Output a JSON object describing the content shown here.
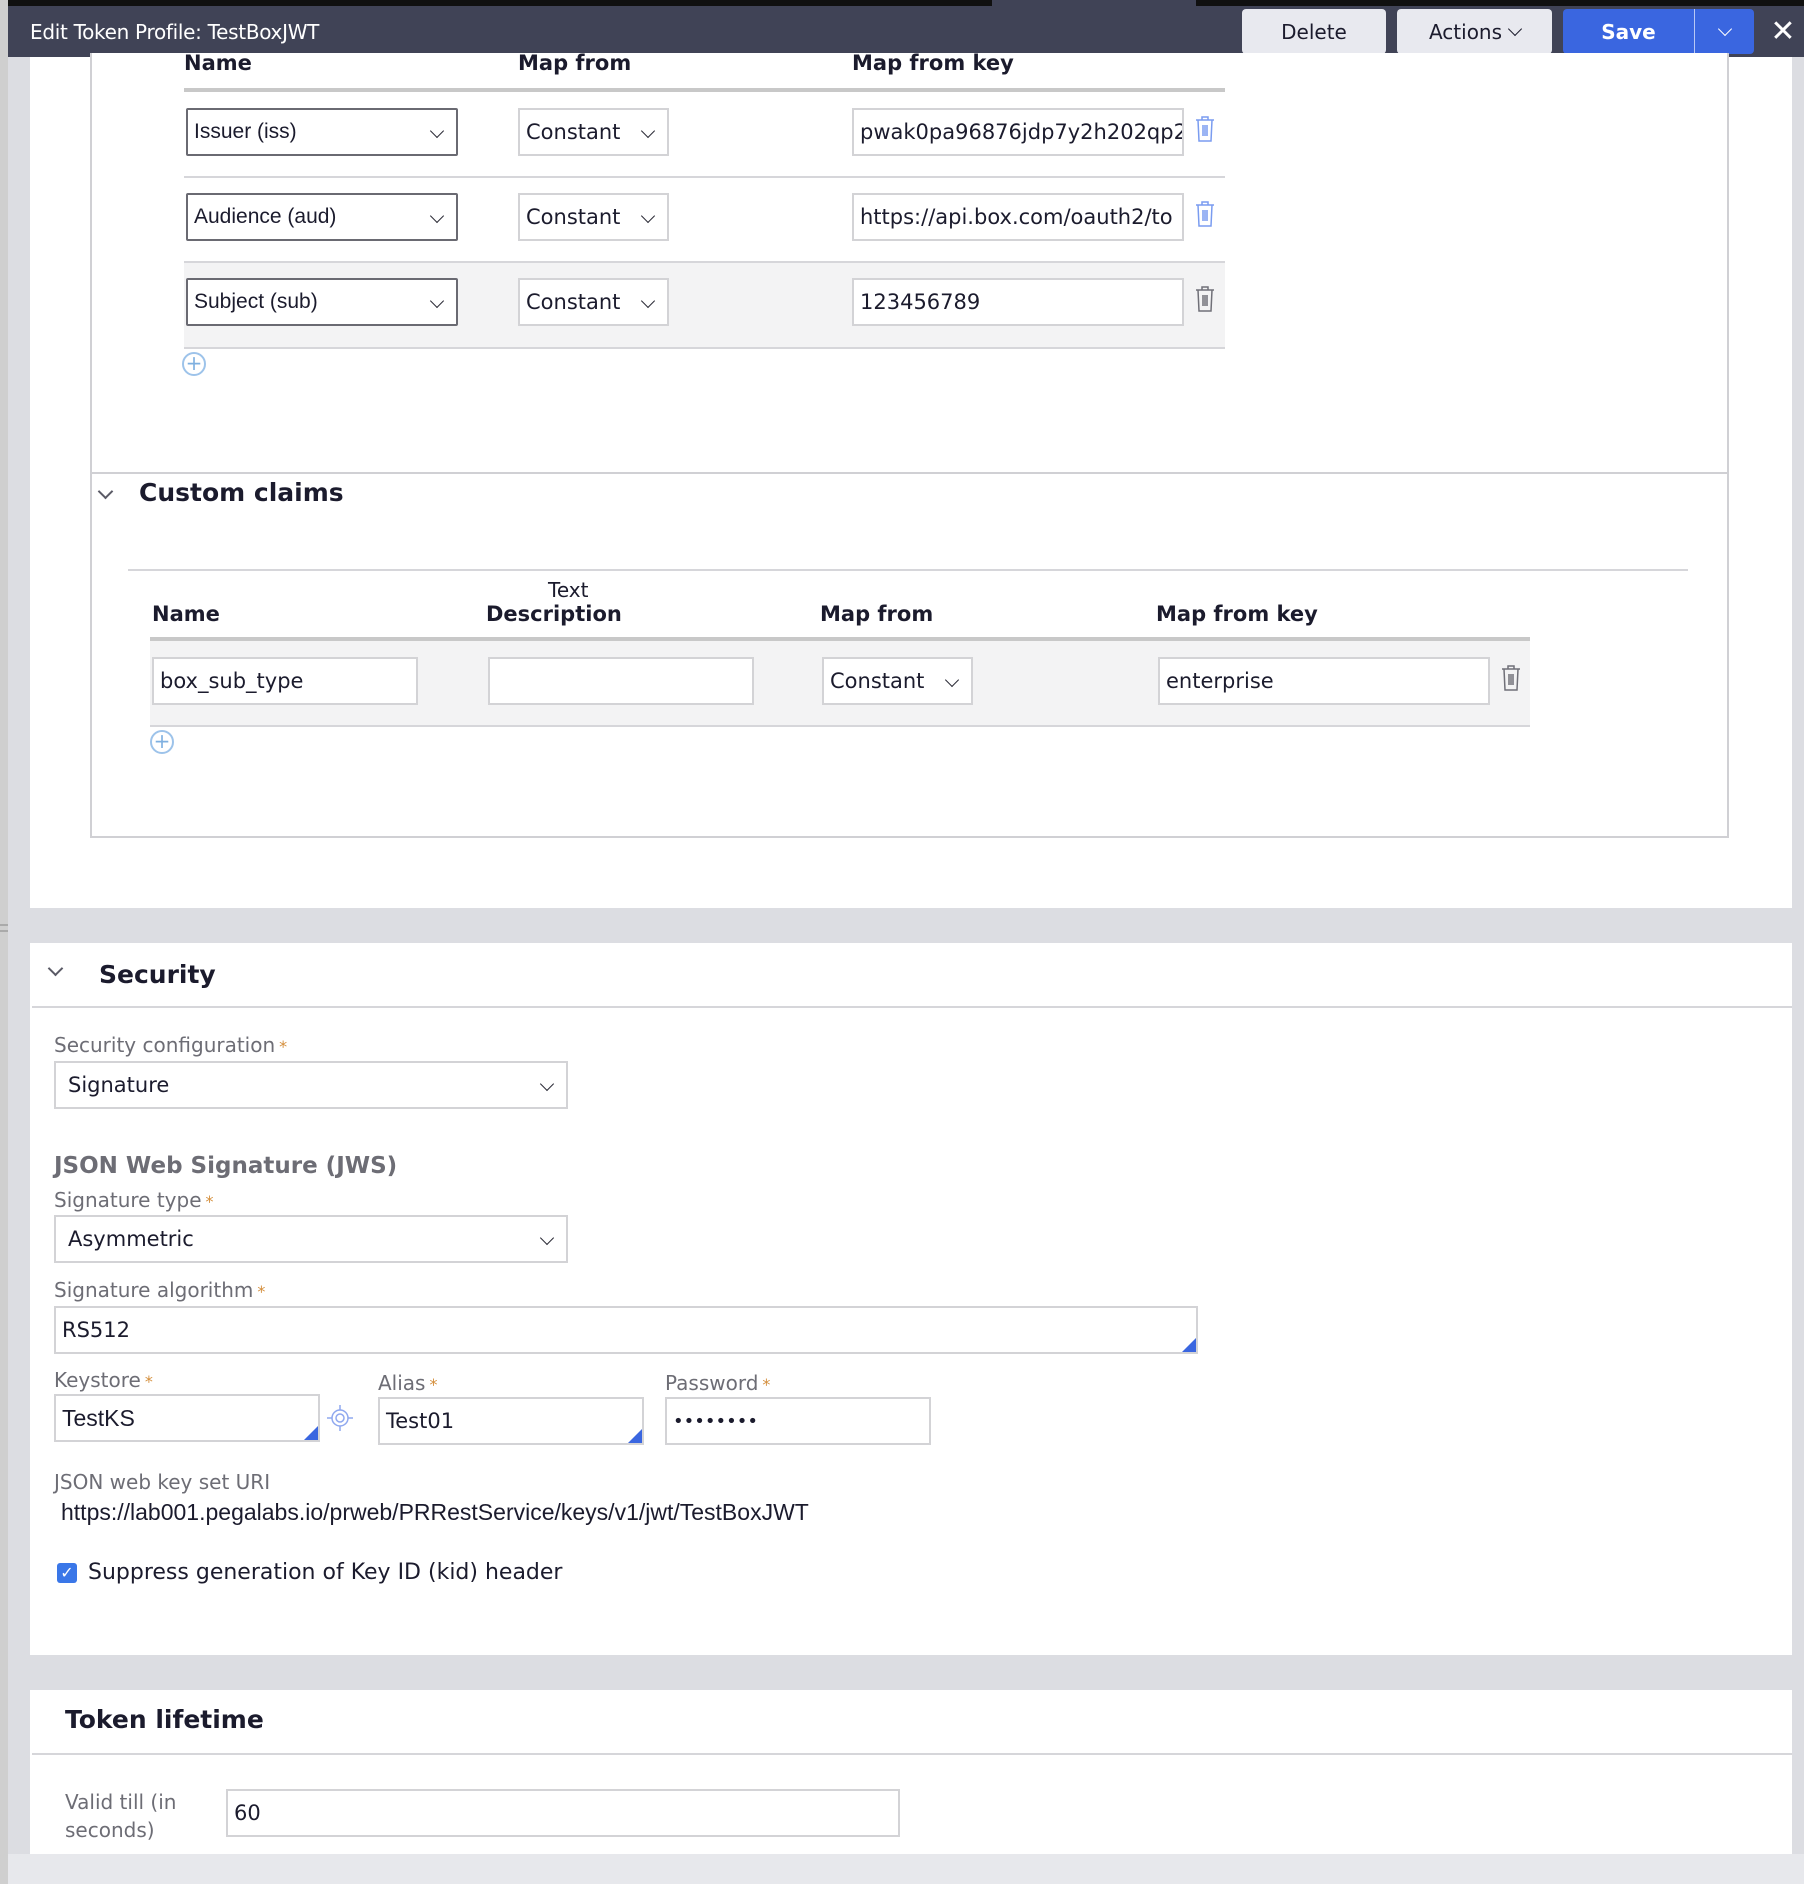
{
  "header": {
    "title": "Edit  Token Profile: TestBoxJWT",
    "delete_label": "Delete",
    "actions_label": "Actions",
    "save_label": "Save",
    "icons": {
      "actions": "chevron-down-icon",
      "save_menu": "chevron-down-icon",
      "close": "close-icon"
    }
  },
  "registered_claims": {
    "columns": [
      "Name",
      "Map from",
      "Map from key"
    ],
    "rows": [
      {
        "name": "Issuer (iss)",
        "map_from": "Constant",
        "key": "pwak0pa96876jdp7y2h202qp2"
      },
      {
        "name": "Audience (aud)",
        "map_from": "Constant",
        "key": "https://api.box.com/oauth2/to"
      },
      {
        "name": "Subject (sub)",
        "map_from": "Constant",
        "key": "123456789"
      }
    ]
  },
  "custom_claims": {
    "title": "Custom claims",
    "columns": {
      "name": "Name",
      "desc_top": "Text",
      "desc": "Description",
      "map_from": "Map from",
      "key": "Map from key"
    },
    "rows": [
      {
        "name": "box_sub_type",
        "description": "",
        "map_from": "Constant",
        "key": "enterprise"
      }
    ]
  },
  "security": {
    "title": "Security",
    "config_label": "Security configuration",
    "config_value": "Signature",
    "jws_heading": "JSON Web Signature (JWS)",
    "sig_type_label": "Signature type",
    "sig_type_value": "Asymmetric",
    "sig_alg_label": "Signature algorithm",
    "sig_alg_value": "RS512",
    "keystore_label": "Keystore",
    "keystore_value": "TestKS",
    "alias_label": "Alias",
    "alias_value": "Test01",
    "password_label": "Password",
    "password_value": "••••••••",
    "jwks_label": "JSON web key set URI",
    "jwks_value": "https://lab001.pegalabs.io/prweb/PRRestService/keys/v1/jwt/TestBoxJWT",
    "suppress_kid_label": "Suppress generation of Key ID (kid) header",
    "suppress_kid_checked": true,
    "required_mark": "*"
  },
  "token_lifetime": {
    "title": "Token lifetime",
    "valid_label_1": "Valid till (in",
    "valid_label_2": "seconds)",
    "valid_value": "60"
  },
  "colors": {
    "header_bg": "#404356",
    "primary": "#3a66e0",
    "required": "#d48e3b",
    "trash_active": "#7a9cf0",
    "trash_idle": "#707078"
  }
}
